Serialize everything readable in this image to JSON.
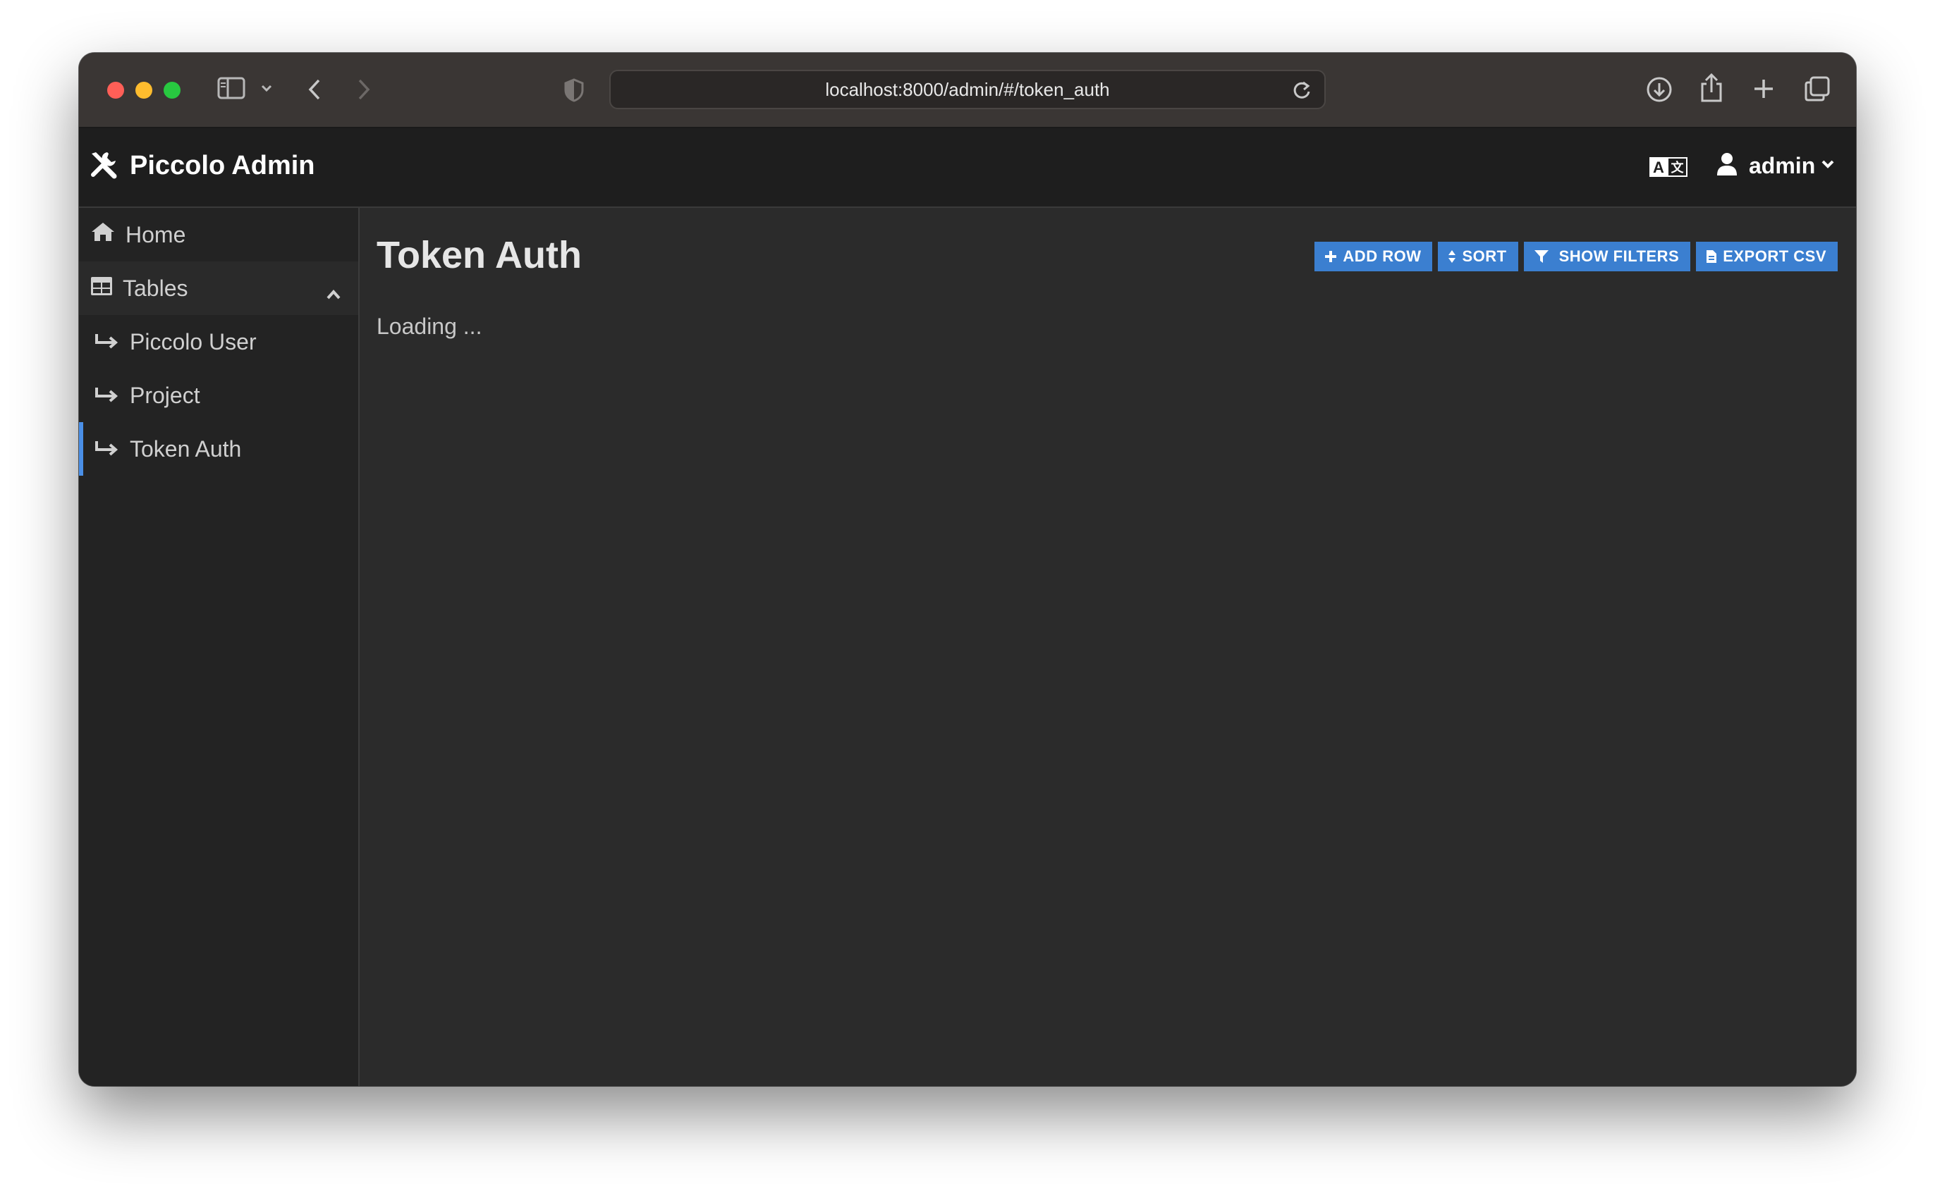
{
  "browser": {
    "url": "localhost:8000/admin/#/token_auth"
  },
  "header": {
    "brand_title": "Piccolo Admin",
    "user_name": "admin"
  },
  "sidebar": {
    "home_label": "Home",
    "tables_label": "Tables",
    "items": [
      {
        "label": "Piccolo User"
      },
      {
        "label": "Project"
      },
      {
        "label": "Token Auth"
      }
    ],
    "active_item": "Token Auth"
  },
  "main": {
    "title": "Token Auth",
    "loading_text": "Loading ...",
    "buttons": {
      "add_row": "ADD ROW",
      "sort": "SORT",
      "show_filters": "SHOW FILTERS",
      "export_csv": "EXPORT CSV"
    }
  },
  "colors": {
    "accent": "#3b7fd0",
    "active_indicator": "#4a8fe7",
    "header_bg": "#1e1e1e",
    "sidebar_bg": "#232323",
    "main_bg": "#2b2b2b"
  }
}
